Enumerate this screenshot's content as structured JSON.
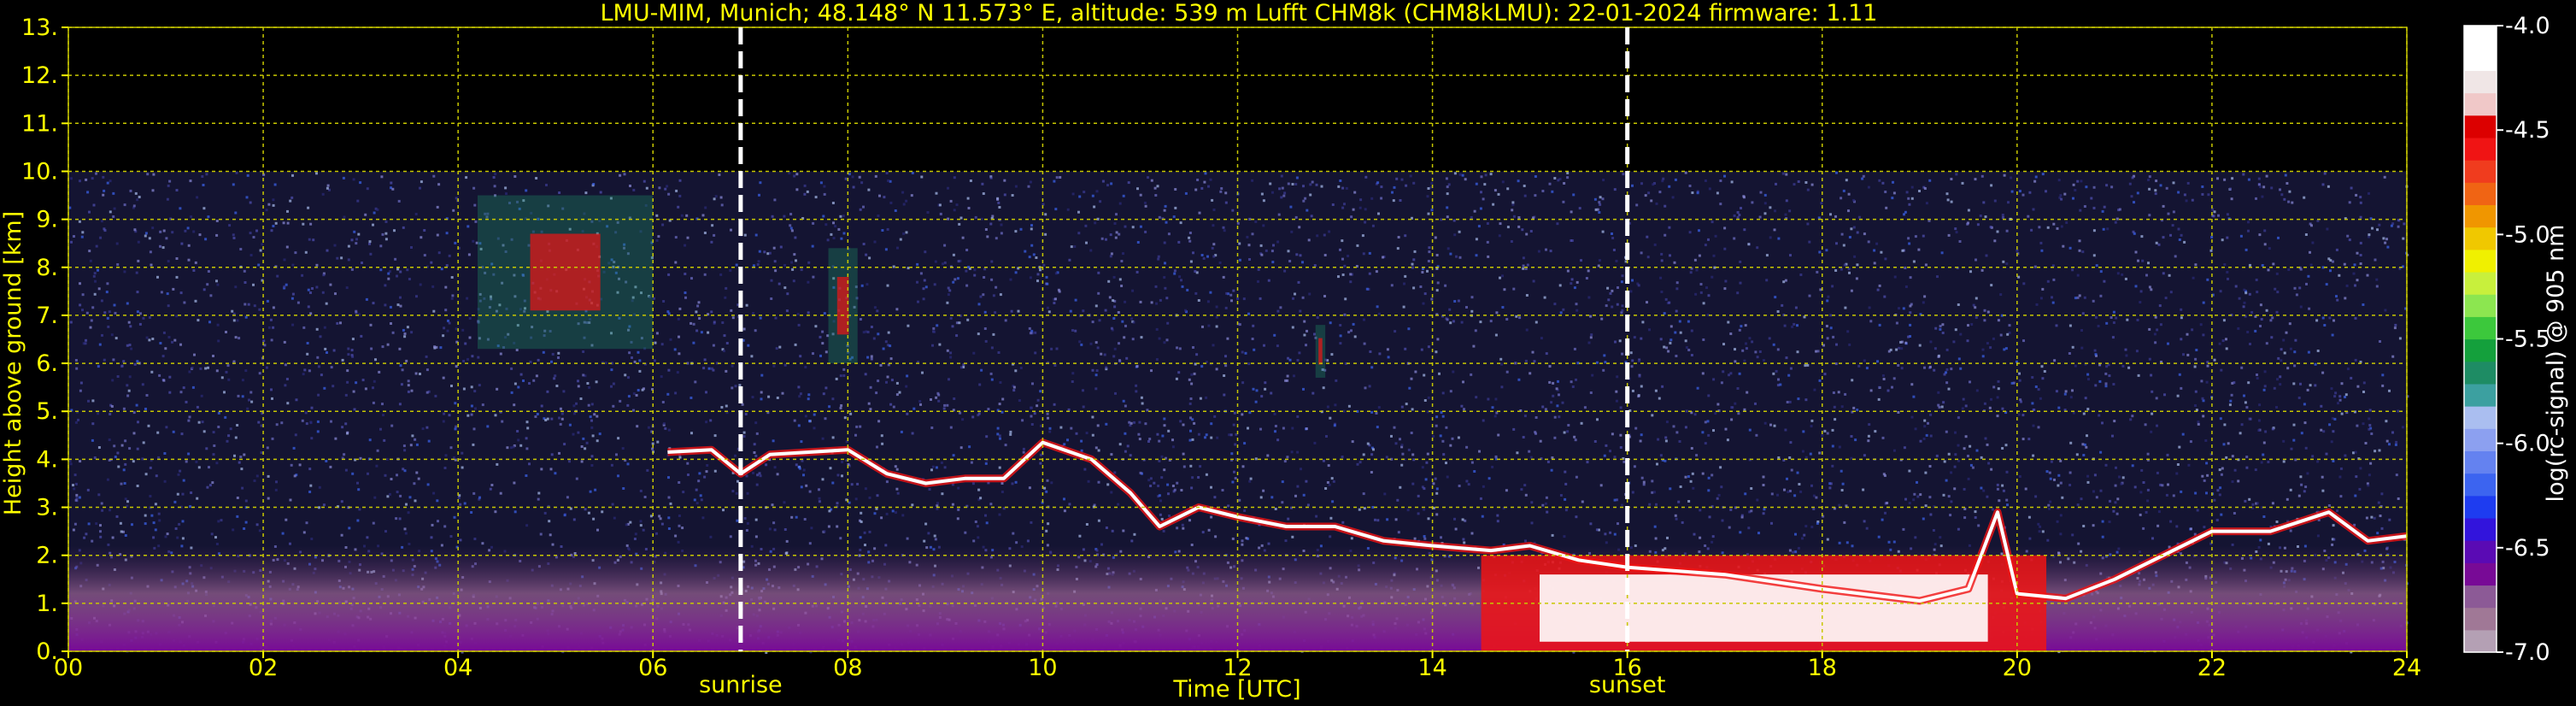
{
  "title": "LMU-MIM, Munich; 48.148° N 11.573° E, altitude: 539 m    Lufft CHM8k (CHM8kLMU): 22-01-2024    firmware: 1.11",
  "chart_data": {
    "type": "heatmap",
    "xlabel": "Time [UTC]",
    "ylabel": "Height above ground [km]",
    "xlim": [
      0,
      24
    ],
    "ylim": [
      0,
      13
    ],
    "x_ticks": [
      "00",
      "02",
      "04",
      "06",
      "08",
      "10",
      "12",
      "14",
      "16",
      "18",
      "20",
      "22",
      "24"
    ],
    "y_ticks": [
      "0.",
      "1.",
      "2.",
      "3.",
      "4.",
      "5.",
      "6.",
      "7.",
      "8.",
      "9.",
      "10.",
      "11.",
      "12.",
      "13."
    ],
    "grid": true,
    "data_ceiling_km": 10,
    "events": [
      {
        "label": "sunrise",
        "time": 6.9
      },
      {
        "label": "sunset",
        "time": 16.0
      }
    ],
    "colorbar": {
      "label": "log(rc-signal) @ 905 nm",
      "ticks": [
        "-4.0",
        "-4.5",
        "-5.0",
        "-5.5",
        "-6.0",
        "-6.5",
        "-7.0"
      ],
      "range": [
        -7.0,
        -4.0
      ],
      "colors": [
        "#b4a0b4",
        "#a07896",
        "#8c5a96",
        "#780a96",
        "#5a0ab4",
        "#3214dc",
        "#1e3cf0",
        "#3c64f0",
        "#6482f0",
        "#8ca0f0",
        "#aabef0",
        "#3ca0a0",
        "#1e8c64",
        "#14a03c",
        "#3cc83c",
        "#8ce650",
        "#c8f03c",
        "#f0f000",
        "#f0c800",
        "#f09600",
        "#f06414",
        "#f03c1e",
        "#f01414",
        "#dc0000",
        "#f0c8c8",
        "#f0e6e6",
        "#ffffff",
        "#ffffff"
      ]
    },
    "cloud_base_layer": [
      [
        6.15,
        4.15
      ],
      [
        6.6,
        4.2
      ],
      [
        6.9,
        3.7
      ],
      [
        7.2,
        4.1
      ],
      [
        7.6,
        4.15
      ],
      [
        8.0,
        4.2
      ],
      [
        8.4,
        3.7
      ],
      [
        8.8,
        3.5
      ],
      [
        9.2,
        3.6
      ],
      [
        9.6,
        3.6
      ],
      [
        10.0,
        4.35
      ],
      [
        10.5,
        4.0
      ],
      [
        10.9,
        3.3
      ],
      [
        11.2,
        2.6
      ],
      [
        11.6,
        3.0
      ],
      [
        12.0,
        2.8
      ],
      [
        12.5,
        2.6
      ],
      [
        13.0,
        2.6
      ],
      [
        13.5,
        2.3
      ],
      [
        14.0,
        2.2
      ],
      [
        14.6,
        2.1
      ],
      [
        15.0,
        2.2
      ],
      [
        15.5,
        1.9
      ],
      [
        16.0,
        1.75
      ],
      [
        17.0,
        1.6
      ],
      [
        18.0,
        1.3
      ],
      [
        19.0,
        1.05
      ],
      [
        19.5,
        1.3
      ],
      [
        19.8,
        2.9
      ],
      [
        20.0,
        1.2
      ],
      [
        20.5,
        1.1
      ],
      [
        21.0,
        1.5
      ],
      [
        21.6,
        2.1
      ],
      [
        22.0,
        2.5
      ],
      [
        22.6,
        2.5
      ],
      [
        23.2,
        2.9
      ],
      [
        23.6,
        2.3
      ],
      [
        24.0,
        2.4
      ]
    ],
    "high_cloud_patches": [
      {
        "t0": 4.2,
        "t1": 6.0,
        "h0": 6.3,
        "h1": 9.5
      },
      {
        "t0": 7.8,
        "t1": 8.1,
        "h0": 6.0,
        "h1": 8.4
      },
      {
        "t0": 12.8,
        "t1": 12.9,
        "h0": 5.7,
        "h1": 6.8
      }
    ],
    "boundary_layer": {
      "t0": 14.5,
      "t1": 20.3,
      "h0": 0.0,
      "h1": 2.0
    }
  }
}
